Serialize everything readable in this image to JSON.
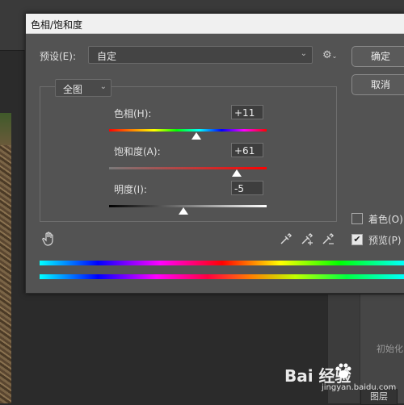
{
  "dialog": {
    "title": "色相/饱和度",
    "preset_label": "预设(E):",
    "preset_value": "自定",
    "ok_label": "确定",
    "cancel_label": "取消",
    "channel_value": "全图",
    "colorize_label": "着色(O)",
    "colorize_checked": false,
    "preview_label": "预览(P)",
    "preview_checked": true
  },
  "sliders": {
    "hue": {
      "label": "色相(H):",
      "value": "+11"
    },
    "saturation": {
      "label": "饱和度(A):",
      "value": "+61"
    },
    "lightness": {
      "label": "明度(I):",
      "value": "-5"
    }
  },
  "icons": {
    "gear": "gear-icon",
    "hand": "hand-target-icon",
    "droppers": [
      "eyedropper-icon",
      "eyedropper-plus-icon",
      "eyedropper-minus-icon"
    ]
  },
  "background": {
    "panel_label": "初始化",
    "layers_tab": "图层",
    "watermark": "Bai 经验",
    "watermark_sub": "jingyan.baidu.com"
  },
  "colors": {
    "dialog_bg": "#535353",
    "titlebar_bg": "#f0f0f0",
    "app_bg": "#2b2b2b"
  }
}
